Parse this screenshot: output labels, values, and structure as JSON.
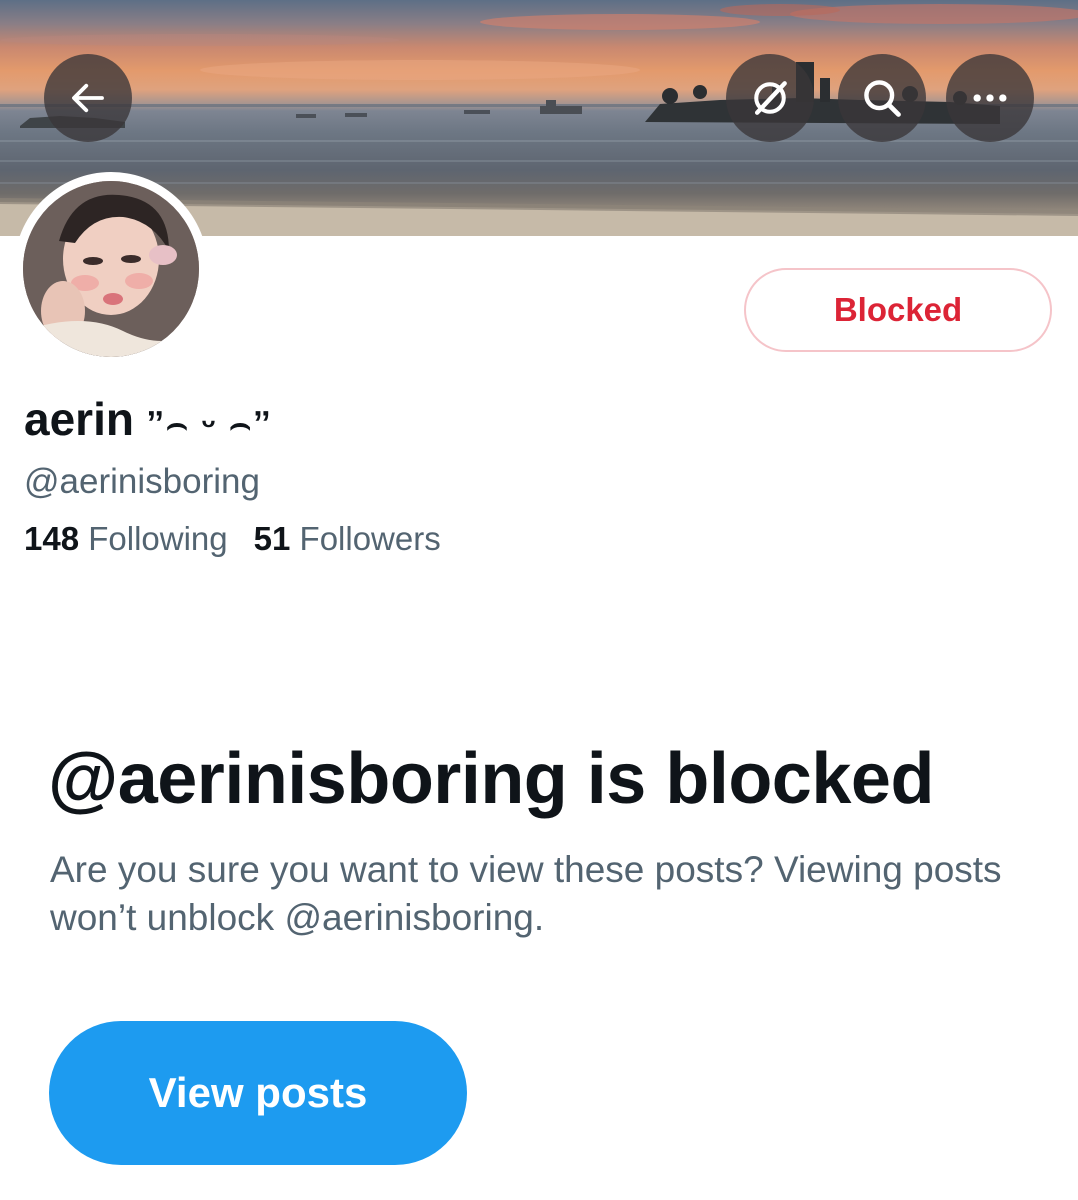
{
  "header": {
    "back_icon": "arrow-left-icon",
    "grok_icon": "grok-icon",
    "search_icon": "search-icon",
    "more_icon": "more-horizontal-icon"
  },
  "profile": {
    "display_name": "aerin",
    "name_decoration": "ˮ⌢ ᵕ ⌢ˮ",
    "handle": "@aerinisboring",
    "following_count": "148",
    "following_label": "Following",
    "followers_count": "51",
    "followers_label": "Followers",
    "blocked_button_label": "Blocked"
  },
  "blocked_notice": {
    "title": "@aerinisboring is blocked",
    "description": "Are you sure you want to view these posts? Viewing posts won’t unblock @aerinisboring.",
    "view_posts_label": "View posts"
  },
  "colors": {
    "accent": "#1d9bf0",
    "blocked_red": "#dc2436",
    "text_primary": "#0f1419",
    "text_secondary": "#536471"
  }
}
